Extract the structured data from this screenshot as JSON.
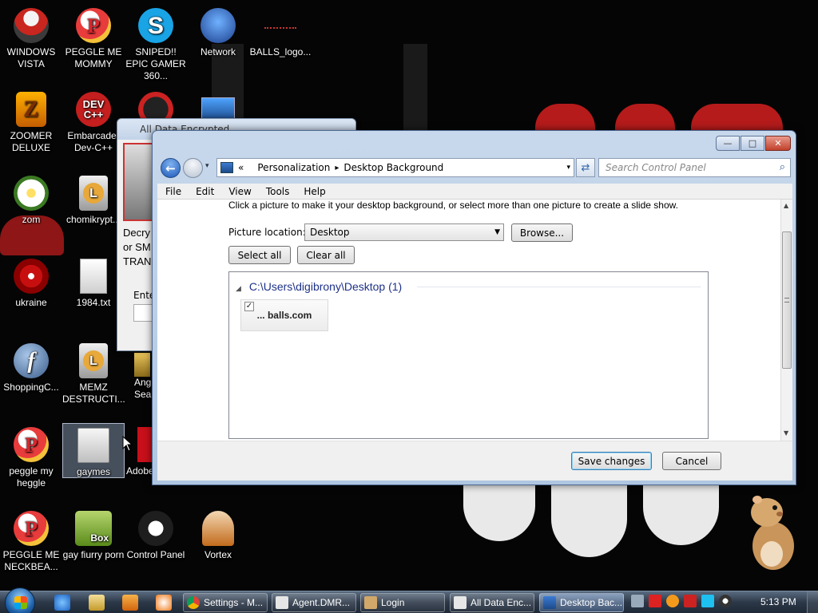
{
  "desktop": {
    "icons": [
      {
        "label": "WINDOWS VISTA",
        "icon": "vista-icon"
      },
      {
        "label": "PEGGLE ME MOMMY",
        "icon": "peggle-icon"
      },
      {
        "label": "SNIPED!! EPIC GAMER 360...",
        "icon": "skype-icon"
      },
      {
        "label": "Network",
        "icon": "network-icon"
      },
      {
        "label": "BALLS_logo...",
        "icon": "image-file-icon"
      },
      {
        "label": "ZOOMER DELUXE",
        "icon": "zoomer-icon"
      },
      {
        "label": "Embarcader Dev-C++",
        "icon": "devcpp-icon"
      },
      {
        "label": "zom",
        "icon": "flower-icon"
      },
      {
        "label": "chomikrypt...",
        "icon": "shortcut-l-icon"
      },
      {
        "label": "ukraine",
        "icon": "radiation-icon"
      },
      {
        "label": "1984.txt",
        "icon": "text-file-icon"
      },
      {
        "label": "ShoppingC...",
        "icon": "flash-icon"
      },
      {
        "label": "MEMZ DESTRUCTI...",
        "icon": "shortcut-l-icon"
      },
      {
        "label": "Angr Sea",
        "icon": "game-icon"
      },
      {
        "label": "peggle my heggle",
        "icon": "peggle-icon"
      },
      {
        "label": "gaymes",
        "icon": "folder-icon"
      },
      {
        "label": "Adobe",
        "icon": "adobe-icon"
      },
      {
        "label": "PEGGLE ME NECKBEA...",
        "icon": "peggle-icon"
      },
      {
        "label": "gay fiurry porn",
        "icon": "box-icon"
      },
      {
        "label": "Control Panel",
        "icon": "control-panel-icon"
      },
      {
        "label": "Vortex",
        "icon": "vortex-icon"
      }
    ]
  },
  "background_window": {
    "title": "All Data Encrypted",
    "text_lines": [
      "Decry",
      "or SM",
      "TRANS"
    ],
    "field_label": "Ente"
  },
  "window": {
    "caption_buttons": {
      "minimize": "—",
      "maximize": "□",
      "close": "✕"
    },
    "nav": {
      "back": "←",
      "dropdown": "▾"
    },
    "address": {
      "chevron": "«",
      "crumbs": [
        "Personalization",
        "Desktop Background"
      ],
      "separator": "▸",
      "dropdown": "▾"
    },
    "refresh": "⇄",
    "search": {
      "placeholder": "Search Control Panel",
      "icon": "⌕"
    },
    "menu": [
      "File",
      "Edit",
      "View",
      "Tools",
      "Help"
    ],
    "instruction": "Click a picture to make it your desktop background, or select more than one picture to create a slide show.",
    "picture_location": {
      "label": "Picture location:",
      "value": "Desktop",
      "dropdown": "▼"
    },
    "buttons": {
      "browse": "Browse...",
      "select_all": "Select all",
      "clear_all": "Clear all",
      "save": "Save changes",
      "cancel": "Cancel"
    },
    "gallery": {
      "group_toggle": "◢",
      "group_title": "C:\\Users\\digibrony\\Desktop (1)",
      "items": [
        {
          "caption": "... balls.com",
          "checked": true,
          "check_mark": "✓"
        }
      ]
    },
    "scrollbar": {
      "up": "▲",
      "down": "▼"
    }
  },
  "taskbar": {
    "tasks": [
      {
        "label": "Settings - M...",
        "icon": "chrome-icon",
        "active": false
      },
      {
        "label": "Agent.DMR...",
        "icon": "window-icon",
        "active": false
      },
      {
        "label": "Login",
        "icon": "app-icon",
        "active": false
      },
      {
        "label": "All Data Enc...",
        "icon": "window-icon",
        "active": false
      },
      {
        "label": "Desktop Bac...",
        "icon": "control-panel-icon",
        "active": true
      }
    ],
    "clock": "5:13 PM"
  }
}
